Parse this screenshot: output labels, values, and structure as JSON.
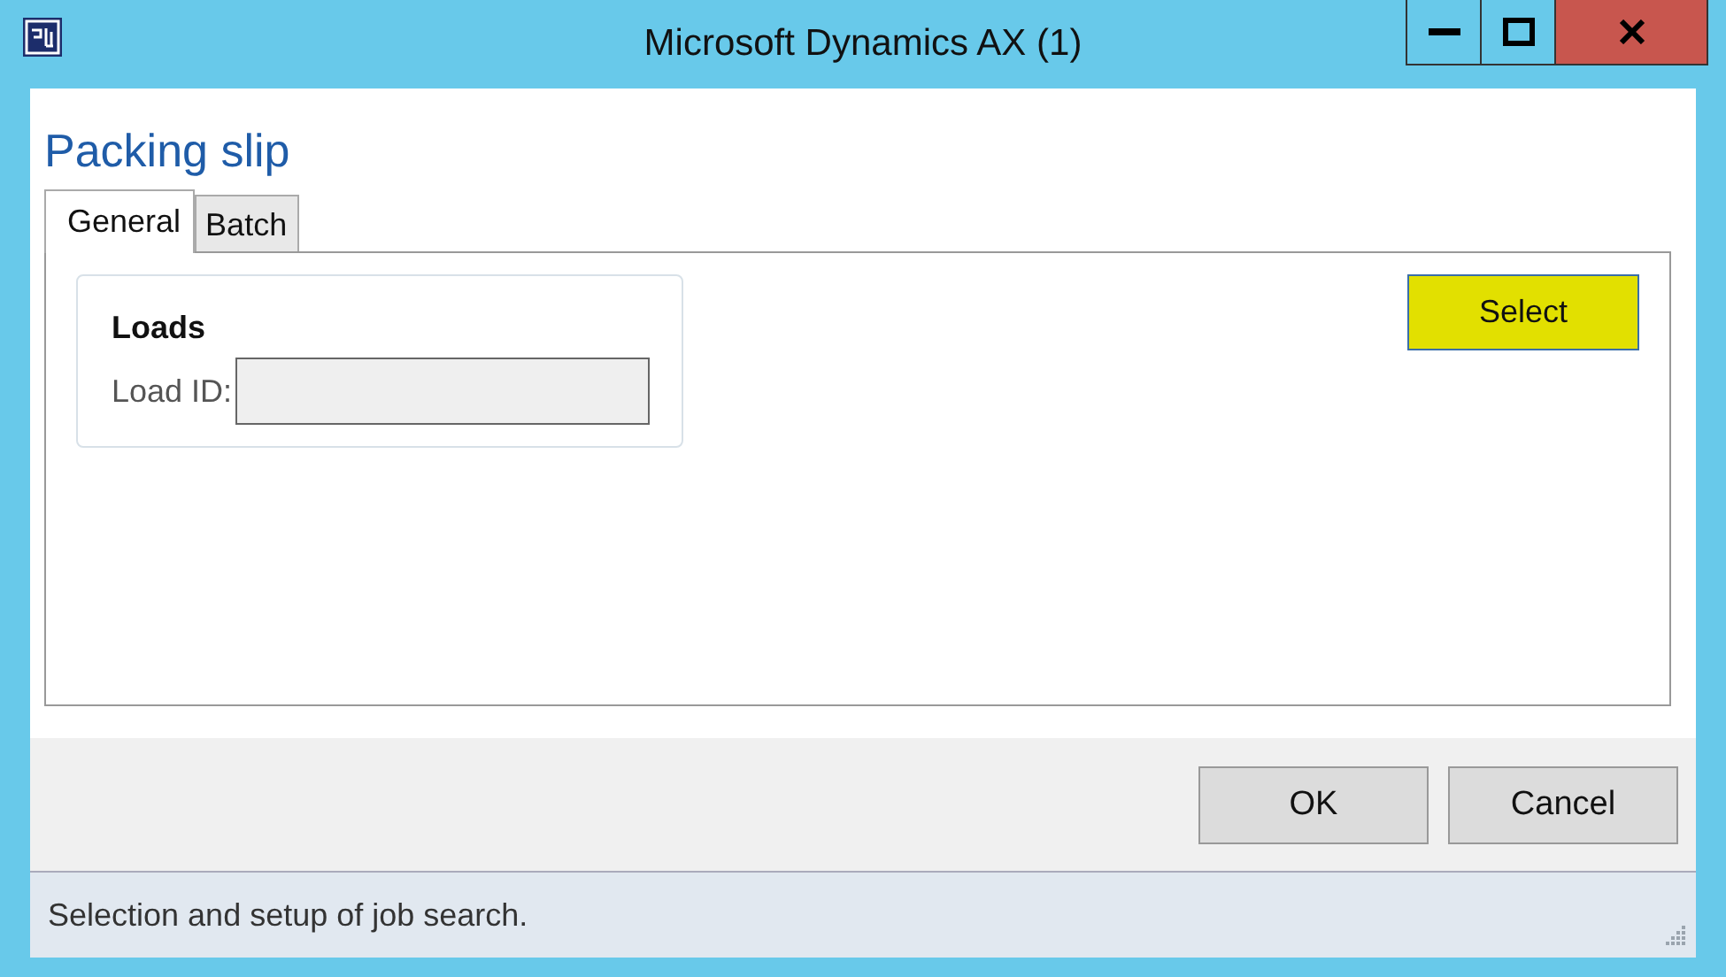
{
  "window": {
    "title": "Microsoft Dynamics AX (1)"
  },
  "form": {
    "title": "Packing slip"
  },
  "tabs": [
    {
      "label": "General",
      "selected": true
    },
    {
      "label": "Batch",
      "selected": false
    }
  ],
  "group": {
    "title": "Loads",
    "fields": [
      {
        "label": "Load ID:"
      }
    ]
  },
  "select_button": {
    "label": "Select",
    "highlighted": true
  },
  "buttons": [
    "OK",
    "Cancel"
  ],
  "status_bar": {
    "text": "Selection and setup of job search."
  }
}
